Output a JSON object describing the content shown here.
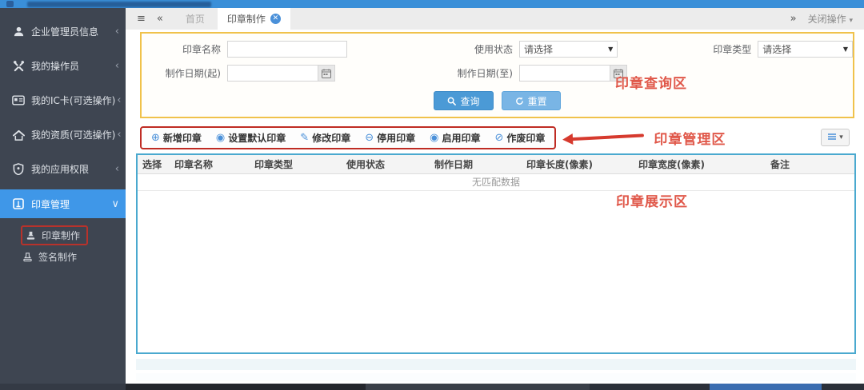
{
  "sidebar": {
    "items": [
      {
        "label": "企业管理员信息",
        "icon": "user-icon",
        "chevron": "‹"
      },
      {
        "label": "我的操作员",
        "icon": "tools-icon",
        "chevron": "‹"
      },
      {
        "label": "我的IC卡(可选操作)",
        "icon": "id-card-icon",
        "chevron": "‹"
      },
      {
        "label": "我的资质(可选操作)",
        "icon": "home-icon",
        "chevron": "‹"
      },
      {
        "label": "我的应用权限",
        "icon": "shield-icon",
        "chevron": "‹"
      },
      {
        "label": "印章管理",
        "icon": "seal-manage-icon",
        "chevron": "∨"
      }
    ],
    "subitems": [
      {
        "label": "印章制作",
        "icon": "stamp-icon"
      },
      {
        "label": "签名制作",
        "icon": "signature-stamp-icon"
      }
    ]
  },
  "tabbar": {
    "home_tab": "首页",
    "active_tab": "印章制作",
    "close_ops_label": "关闭操作"
  },
  "search": {
    "seal_name_label": "印章名称",
    "use_status_label": "使用状态",
    "seal_type_label": "印章类型",
    "date_from_label": "制作日期(起)",
    "date_to_label": "制作日期(至)",
    "select_placeholder": "请选择",
    "query_label": "查询",
    "reset_label": "重置",
    "annotation": "印章查询区"
  },
  "toolbar": {
    "buttons": [
      {
        "label": "新增印章",
        "icon": "add-circle-icon",
        "glyph": "⊕"
      },
      {
        "label": "设置默认印章",
        "icon": "default-circle-icon",
        "glyph": "◉"
      },
      {
        "label": "修改印章",
        "icon": "edit-pencil-icon",
        "glyph": "✎"
      },
      {
        "label": "停用印章",
        "icon": "disable-circle-icon",
        "glyph": "⊖"
      },
      {
        "label": "启用印章",
        "icon": "enable-circle-icon",
        "glyph": "◉"
      },
      {
        "label": "作废印章",
        "icon": "void-circle-icon",
        "glyph": "⊘"
      }
    ],
    "annotation": "印章管理区"
  },
  "table": {
    "headers": [
      "选择",
      "印章名称",
      "印章类型",
      "使用状态",
      "制作日期",
      "印章长度(像素)",
      "印章宽度(像素)",
      "备注"
    ],
    "empty_text": "无匹配数据",
    "annotation": "印章展示区"
  },
  "colors": {
    "accent_blue": "#4a96d9",
    "sidebar_bg": "#3e4551",
    "active_item_blue": "#3f97e8",
    "panel_border_yellow": "#f0c24b",
    "table_border_blue": "#4aa9cf",
    "annotation_red": "#e0584a"
  }
}
